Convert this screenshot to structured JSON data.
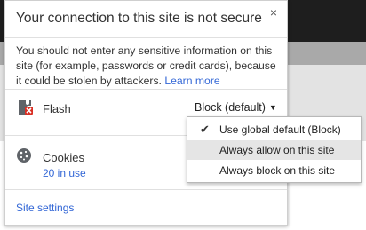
{
  "popup": {
    "title": "Your connection to this site is not secure",
    "close_glyph": "×",
    "warning_text": "You should not enter any sensitive information on this site (for example, passwords or credit cards), because it could be stolen by attackers.",
    "learn_more": "Learn more",
    "flash": {
      "label": "Flash",
      "icon": "flash-plugin-blocked-icon",
      "selected": "Block (default)"
    },
    "dropdown": {
      "options": [
        {
          "label": "Use global default (Block)",
          "checked": true,
          "hovered": false
        },
        {
          "label": "Always allow on this site",
          "checked": false,
          "hovered": true
        },
        {
          "label": "Always block on this site",
          "checked": false,
          "hovered": false
        }
      ]
    },
    "cookies": {
      "label": "Cookies",
      "icon": "cookie-icon",
      "count": "20 in use"
    },
    "site_settings": "Site settings"
  },
  "colors": {
    "link": "#3367d6",
    "hover": "#e5e5e5",
    "background_dark": "#1e1e1e"
  }
}
